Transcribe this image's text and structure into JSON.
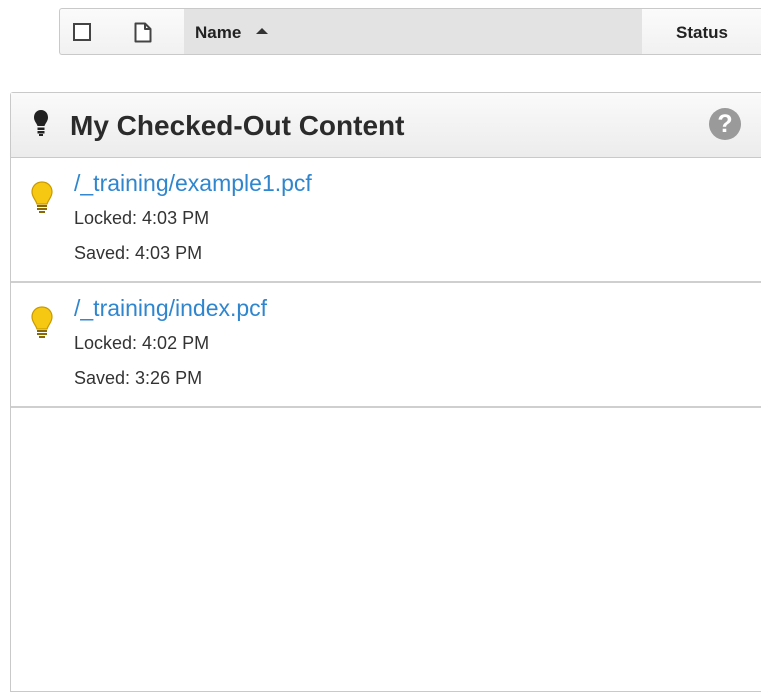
{
  "file_header": {
    "name_label": "Name",
    "status_label": "Status"
  },
  "panel": {
    "title": "My Checked-Out Content",
    "help_glyph": "?",
    "items": [
      {
        "path": "/_training/example1.pcf",
        "locked": "Locked: 4:03 PM",
        "saved": "Saved: 4:03 PM",
        "icon": "lightbulb-icon"
      },
      {
        "path": "/_training/index.pcf",
        "locked": "Locked: 4:02 PM",
        "saved": "Saved: 3:26 PM",
        "icon": "lightbulb-icon"
      }
    ]
  },
  "colors": {
    "link": "#2f86cf",
    "bulb": "#f4c20d",
    "help": "#9a9a9a"
  }
}
